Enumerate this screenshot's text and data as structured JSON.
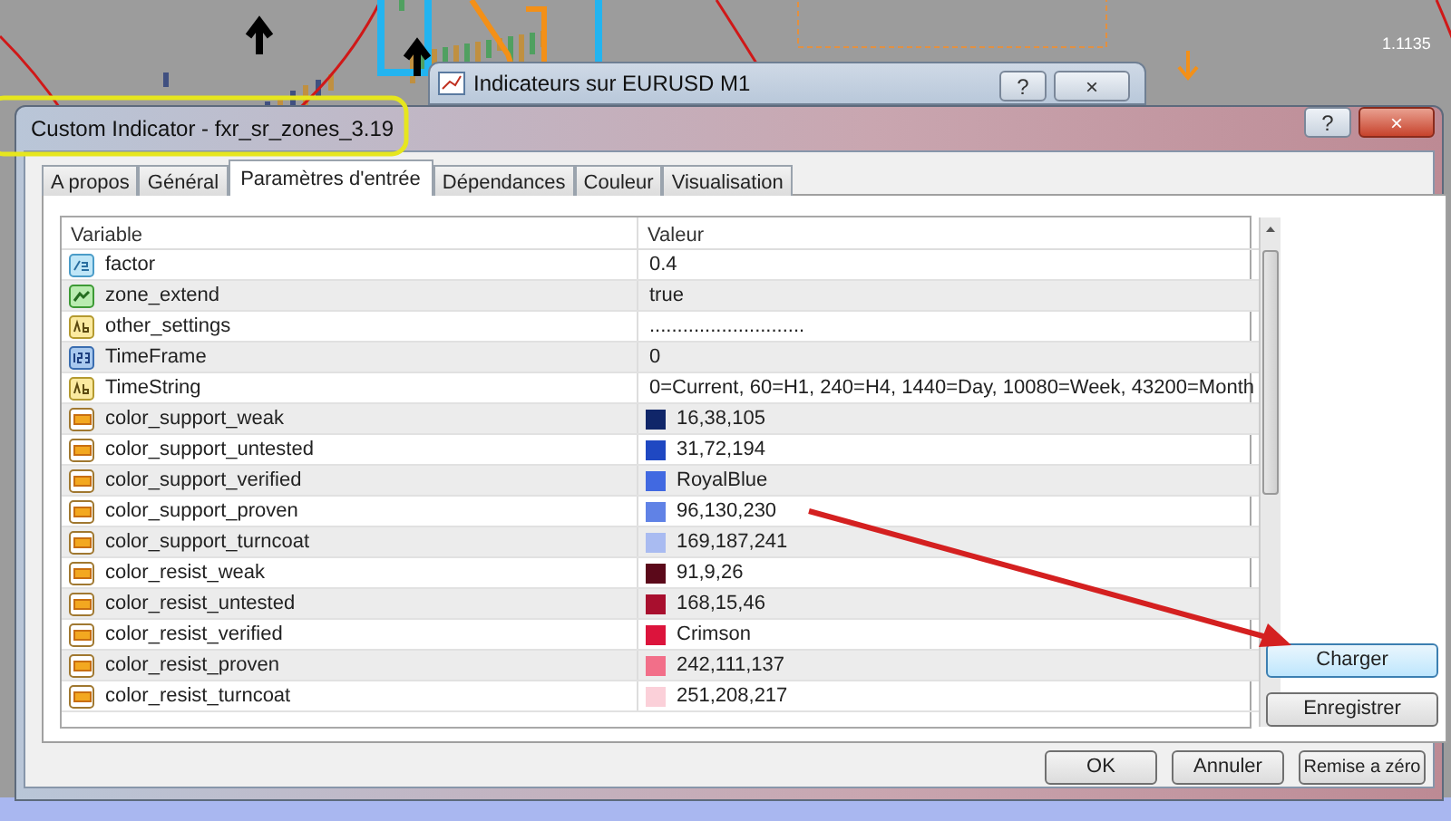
{
  "chart": {
    "price_label": "1.1135"
  },
  "back_window": {
    "title": "Indicateurs sur EURUSD M1",
    "help": "?",
    "close": "×"
  },
  "window": {
    "title": "Custom Indicator - fxr_sr_zones_3.19",
    "help": "?",
    "close": "×"
  },
  "tabs": [
    {
      "label": "A propos",
      "selected": false
    },
    {
      "label": "Général",
      "selected": false
    },
    {
      "label": "Paramètres d'entrée",
      "selected": true
    },
    {
      "label": "Dépendances",
      "selected": false
    },
    {
      "label": "Couleur",
      "selected": false
    },
    {
      "label": "Visualisation",
      "selected": false
    }
  ],
  "table": {
    "columns": [
      "Variable",
      "Valeur"
    ],
    "rows": [
      {
        "kind": "double",
        "variable": "factor",
        "value": "0.4"
      },
      {
        "kind": "bool",
        "variable": "zone_extend",
        "value": "true"
      },
      {
        "kind": "string",
        "variable": "other_settings",
        "value": "............................"
      },
      {
        "kind": "int",
        "variable": "TimeFrame",
        "value": "0"
      },
      {
        "kind": "string",
        "variable": "TimeString",
        "value": "0=Current, 60=H1, 240=H4, 1440=Day, 10080=Week, 43200=Month"
      },
      {
        "kind": "color",
        "variable": "color_support_weak",
        "value": "16,38,105",
        "color": "#102669"
      },
      {
        "kind": "color",
        "variable": "color_support_untested",
        "value": "31,72,194",
        "color": "#1f48c2"
      },
      {
        "kind": "color",
        "variable": "color_support_verified",
        "value": "RoyalBlue",
        "color": "#4169e1"
      },
      {
        "kind": "color",
        "variable": "color_support_proven",
        "value": "96,130,230",
        "color": "#6082e6"
      },
      {
        "kind": "color",
        "variable": "color_support_turncoat",
        "value": "169,187,241",
        "color": "#a9bbf1"
      },
      {
        "kind": "color",
        "variable": "color_resist_weak",
        "value": "91,9,26",
        "color": "#5b091a"
      },
      {
        "kind": "color",
        "variable": "color_resist_untested",
        "value": "168,15,46",
        "color": "#a80f2e"
      },
      {
        "kind": "color",
        "variable": "color_resist_verified",
        "value": "Crimson",
        "color": "#dc143c"
      },
      {
        "kind": "color",
        "variable": "color_resist_proven",
        "value": "242,111,137",
        "color": "#f26f89"
      },
      {
        "kind": "color",
        "variable": "color_resist_turncoat",
        "value": "251,208,217",
        "color": "#fbd0d9"
      }
    ]
  },
  "side_buttons": [
    {
      "label": "Charger",
      "focused": true
    },
    {
      "label": "Enregistrer",
      "focused": false
    }
  ],
  "bottom_buttons": [
    "OK",
    "Annuler",
    "Remise a zéro"
  ]
}
